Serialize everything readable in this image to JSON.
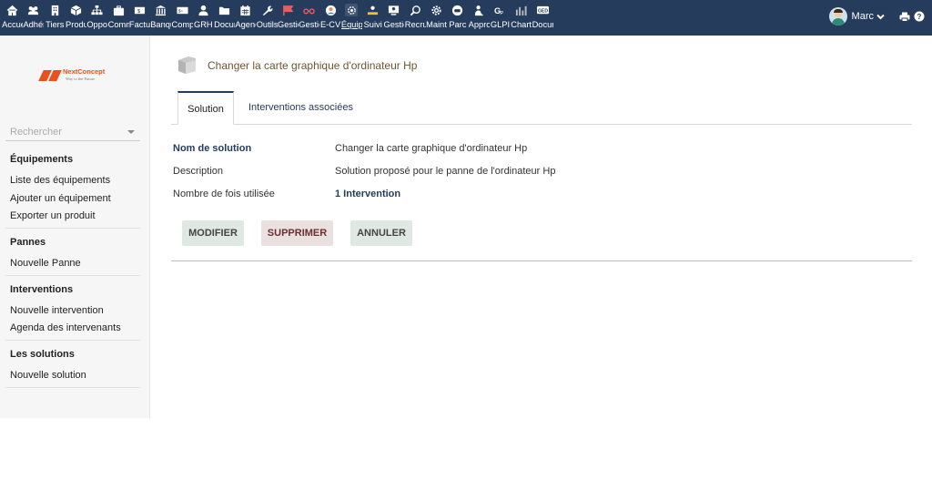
{
  "topmenu": [
    {
      "label": "Accueil",
      "icon": "home-icon"
    },
    {
      "label": "Adhérents",
      "icon": "users-icon"
    },
    {
      "label": "Tiers",
      "icon": "building-icon"
    },
    {
      "label": "Produits",
      "icon": "box-icon"
    },
    {
      "label": "Opportunités",
      "icon": "sitemap-icon"
    },
    {
      "label": "Commercial",
      "icon": "briefcase-icon"
    },
    {
      "label": "Factures",
      "icon": "invoice-icon"
    },
    {
      "label": "Banque",
      "icon": "bank-icon"
    },
    {
      "label": "Compta",
      "icon": "cash-icon"
    },
    {
      "label": "GRH",
      "icon": "user-tie-icon"
    },
    {
      "label": "Documents",
      "icon": "folder-icon"
    },
    {
      "label": "Agenda",
      "icon": "calendar-icon"
    },
    {
      "label": "Outils",
      "icon": "wrench-icon"
    },
    {
      "label": "Gestion",
      "icon": "flag-icon"
    },
    {
      "label": "Gestion",
      "icon": "glasses-icon"
    },
    {
      "label": "E-CV",
      "icon": "face-icon"
    },
    {
      "label": "Équipements",
      "icon": "gear-network-icon"
    },
    {
      "label": "Suivi",
      "icon": "person-desk-icon"
    },
    {
      "label": "Gestion",
      "icon": "monitor-user-icon"
    },
    {
      "label": "Recrutement",
      "icon": "search-user-icon"
    },
    {
      "label": "Maintenance",
      "icon": "cog-icon"
    },
    {
      "label": "Parc",
      "icon": "car-icon"
    },
    {
      "label": "Appro",
      "icon": "dolly-icon"
    },
    {
      "label": "GLPI",
      "icon": "glpi-icon"
    },
    {
      "label": "Charts",
      "icon": "chart-icon"
    },
    {
      "label": "Documents",
      "icon": "ged-icon"
    }
  ],
  "active_menu_index": 16,
  "user": {
    "name": "Marc"
  },
  "brand": {
    "name": "NextConcept",
    "tagline": "Way to the Future"
  },
  "sidebar": {
    "search_placeholder": "Rechercher",
    "sections": [
      {
        "title": "Équipements",
        "links": [
          "Liste des équipements",
          "Ajouter un équipement",
          "Exporter un produit"
        ]
      },
      {
        "title": "Pannes",
        "links": [
          "Nouvelle Panne"
        ]
      },
      {
        "title": "Interventions",
        "links": [
          "Nouvelle intervention",
          "Agenda des intervenants"
        ]
      },
      {
        "title": "Les solutions",
        "links": [
          "Nouvelle solution"
        ]
      }
    ]
  },
  "page": {
    "title": "Changer la carte graphique d'ordinateur Hp"
  },
  "tabs": [
    {
      "label": "Solution",
      "active": true
    },
    {
      "label": "Interventions associées",
      "active": false
    }
  ],
  "fields": [
    {
      "label": "Nom de solution",
      "value": "Changer la carte graphique d'ordinateur Hp"
    },
    {
      "label": "Description",
      "value": "Solution proposé pour le panne de l'ordinateur Hp"
    },
    {
      "label": "Nombre de fois utilisée",
      "value": "1 Intervention"
    }
  ],
  "buttons": {
    "modify": "MODIFIER",
    "delete": "SUPPRIMER",
    "cancel": "ANNULER"
  },
  "colors": {
    "topbar": "#263c5c",
    "title": "#6e5531",
    "logo": "#e8501e"
  }
}
